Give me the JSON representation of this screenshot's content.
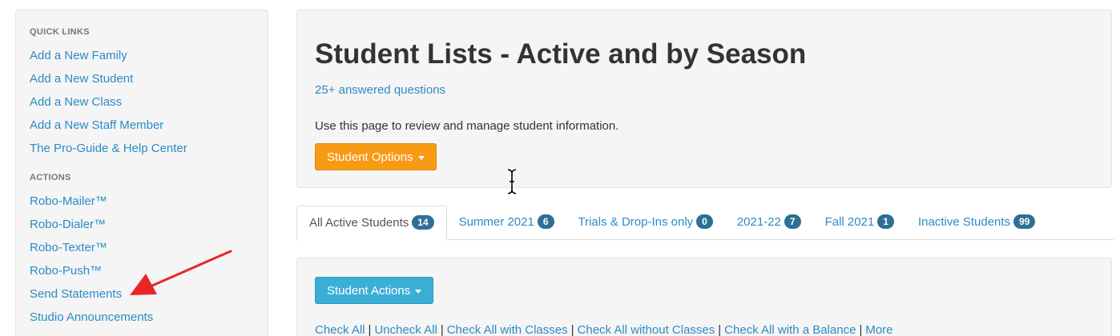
{
  "sidebar": {
    "quick_links_heading": "QUICK LINKS",
    "quick_links": [
      {
        "label": "Add a New Family"
      },
      {
        "label": "Add a New Student"
      },
      {
        "label": "Add a New Class"
      },
      {
        "label": "Add a New Staff Member"
      },
      {
        "label": "The Pro-Guide & Help Center"
      }
    ],
    "actions_heading": "ACTIONS",
    "actions": [
      {
        "label": "Robo-Mailer™"
      },
      {
        "label": "Robo-Dialer™"
      },
      {
        "label": "Robo-Texter™"
      },
      {
        "label": "Robo-Push™"
      },
      {
        "label": "Send Statements"
      },
      {
        "label": "Studio Announcements"
      }
    ]
  },
  "header": {
    "title": "Student Lists - Active and by Season",
    "answered_link": "25+ answered questions",
    "description": "Use this page to review and manage student information.",
    "options_button": "Student Options"
  },
  "tabs": [
    {
      "label": "All Active Students",
      "count": "14",
      "active": true
    },
    {
      "label": "Summer 2021",
      "count": "6"
    },
    {
      "label": "Trials & Drop-Ins only",
      "count": "0"
    },
    {
      "label": "2021-22",
      "count": "7"
    },
    {
      "label": "Fall 2021",
      "count": "1"
    },
    {
      "label": "Inactive Students",
      "count": "99"
    }
  ],
  "actions_panel": {
    "actions_button": "Student Actions",
    "check_links": [
      {
        "label": "Check All"
      },
      {
        "label": "Uncheck All"
      },
      {
        "label": "Check All with Classes"
      },
      {
        "label": "Check All without Classes"
      },
      {
        "label": "Check All with a Balance"
      },
      {
        "label": "More"
      }
    ],
    "separator": "|"
  },
  "colors": {
    "link": "#2a8bc6",
    "orange_button": "#f79a14",
    "blue_button": "#3baed6",
    "badge": "#2e6f95",
    "annotation_arrow": "#e8262a"
  },
  "icons": {
    "cursor": "text-cursor-icon",
    "annotation": "red-arrow-annotation"
  }
}
